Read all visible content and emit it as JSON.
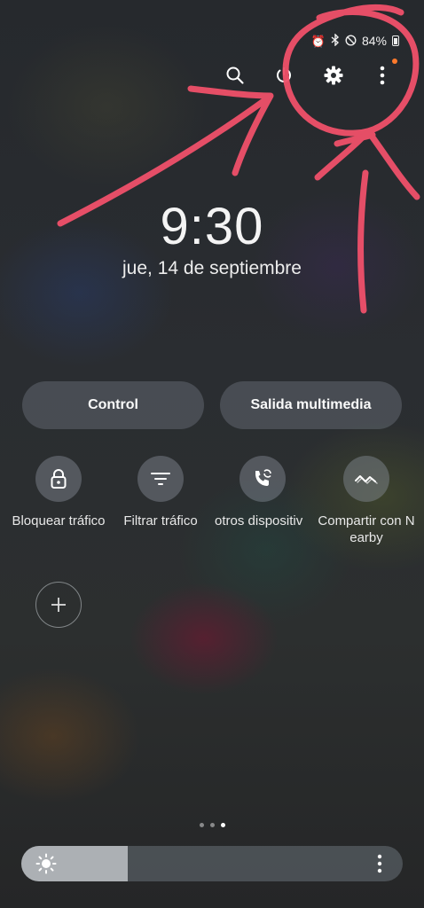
{
  "status_bar": {
    "icons": [
      "alarm-icon",
      "bluetooth-icon",
      "do-not-disturb-icon",
      "battery-icon"
    ],
    "battery_percent": "84%"
  },
  "top_actions": [
    "search-icon",
    "power-icon",
    "settings-icon",
    "more-vertical-icon"
  ],
  "clock": {
    "time": "9:30",
    "date": "jue, 14 de septiembre"
  },
  "buttons": {
    "control": "Control",
    "media_output": "Salida multimedia"
  },
  "tiles": [
    {
      "label": "Bloquear tráfico",
      "icon": "lock-icon"
    },
    {
      "label": "Filtrar tráfico",
      "icon": "filter-icon"
    },
    {
      "label": "otros dispositiv",
      "icon": "call-sync-icon"
    },
    {
      "label": "Compartir con N earby",
      "icon": "nearby-share-icon"
    }
  ],
  "pager": {
    "pages": 3,
    "active": 2
  },
  "brightness": {
    "level": 0.28,
    "icon": "sun-icon"
  },
  "colors": {
    "annotation": "#f0506a",
    "notification_dot": "#ff7a2c"
  }
}
